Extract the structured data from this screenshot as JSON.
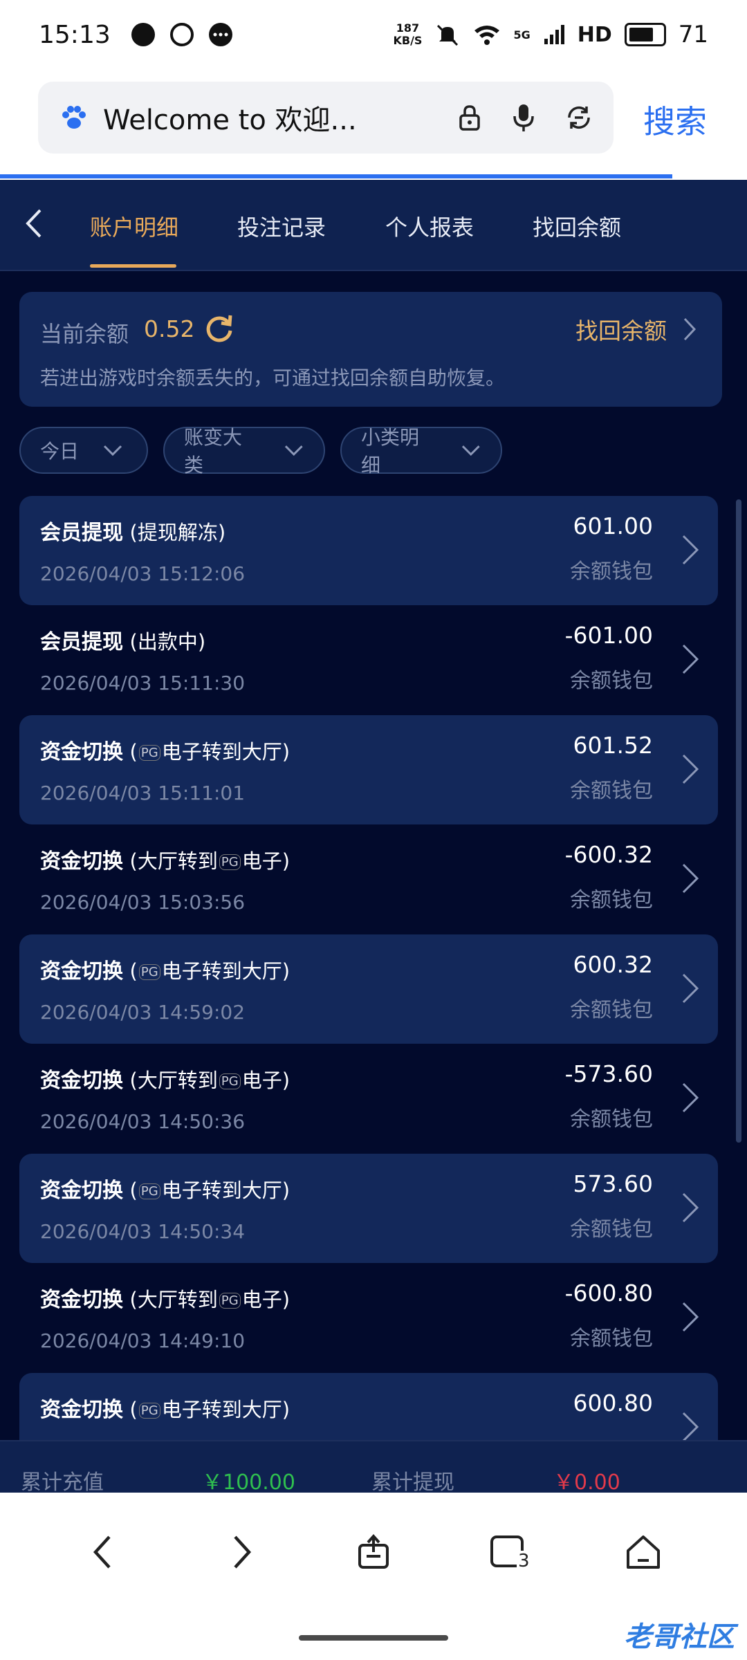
{
  "status_bar": {
    "time": "15:13",
    "net_speed_top": "187",
    "net_speed_bottom": "KB/S",
    "network": "5G",
    "hd": "HD",
    "battery": "71"
  },
  "browser": {
    "url_text": "Welcome to 欢迎...",
    "search_label": "搜索"
  },
  "tabs": [
    {
      "label": "账户明细",
      "active": true
    },
    {
      "label": "投注记录",
      "active": false
    },
    {
      "label": "个人报表",
      "active": false
    },
    {
      "label": "找回余额",
      "active": false
    }
  ],
  "balance": {
    "label": "当前余额",
    "value": "0.52",
    "recover_label": "找回余额",
    "description": "若进出游戏时余额丢失的，可通过找回余额自助恢复。"
  },
  "filters": [
    {
      "label": "今日"
    },
    {
      "label": "账变大类"
    },
    {
      "label": "小类明细"
    }
  ],
  "transactions": [
    {
      "type": "会员提现",
      "detail": "(提现解冻)",
      "time": "2026/04/03 15:12:06",
      "amount": "601.00",
      "wallet": "余额钱包",
      "highlight": true
    },
    {
      "type": "会员提现",
      "detail": "(出款中)",
      "time": "2026/04/03 15:11:30",
      "amount": "-601.00",
      "wallet": "余额钱包",
      "highlight": false
    },
    {
      "type": "资金切换",
      "detail_pre": "(",
      "detail_post": "电子转到大厅)",
      "time": "2026/04/03 15:11:01",
      "amount": "601.52",
      "wallet": "余额钱包",
      "highlight": true
    },
    {
      "type": "资金切换",
      "detail_pre": "(大厅转到",
      "detail_post": "电子)",
      "time": "2026/04/03 15:03:56",
      "amount": "-600.32",
      "wallet": "余额钱包",
      "highlight": false
    },
    {
      "type": "资金切换",
      "detail_pre": "(",
      "detail_post": "电子转到大厅)",
      "time": "2026/04/03 14:59:02",
      "amount": "600.32",
      "wallet": "余额钱包",
      "highlight": true
    },
    {
      "type": "资金切换",
      "detail_pre": "(大厅转到",
      "detail_post": "电子)",
      "time": "2026/04/03 14:50:36",
      "amount": "-573.60",
      "wallet": "余额钱包",
      "highlight": false
    },
    {
      "type": "资金切换",
      "detail_pre": "(",
      "detail_post": "电子转到大厅)",
      "time": "2026/04/03 14:50:34",
      "amount": "573.60",
      "wallet": "余额钱包",
      "highlight": true
    },
    {
      "type": "资金切换",
      "detail_pre": "(大厅转到",
      "detail_post": "电子)",
      "time": "2026/04/03 14:49:10",
      "amount": "-600.80",
      "wallet": "余额钱包",
      "highlight": false
    },
    {
      "type": "资金切换",
      "detail_pre": "(",
      "detail_post": "电子转到大厅)",
      "time": "",
      "amount": "600.80",
      "wallet": "",
      "highlight": true
    }
  ],
  "pg_badge": "PG",
  "summary": {
    "recharge_label": "累计充值",
    "recharge_value": "￥100.00",
    "withdraw_label": "累计提现",
    "withdraw_value": "￥0.00",
    "recharge_color": "#2fbf4f",
    "withdraw_color": "#e23a4b"
  },
  "bottom_nav": {
    "tab_count": "3",
    "watermark": "老哥社区"
  },
  "colors": {
    "accent": "#e8a95a",
    "link": "#2b6ff0"
  }
}
